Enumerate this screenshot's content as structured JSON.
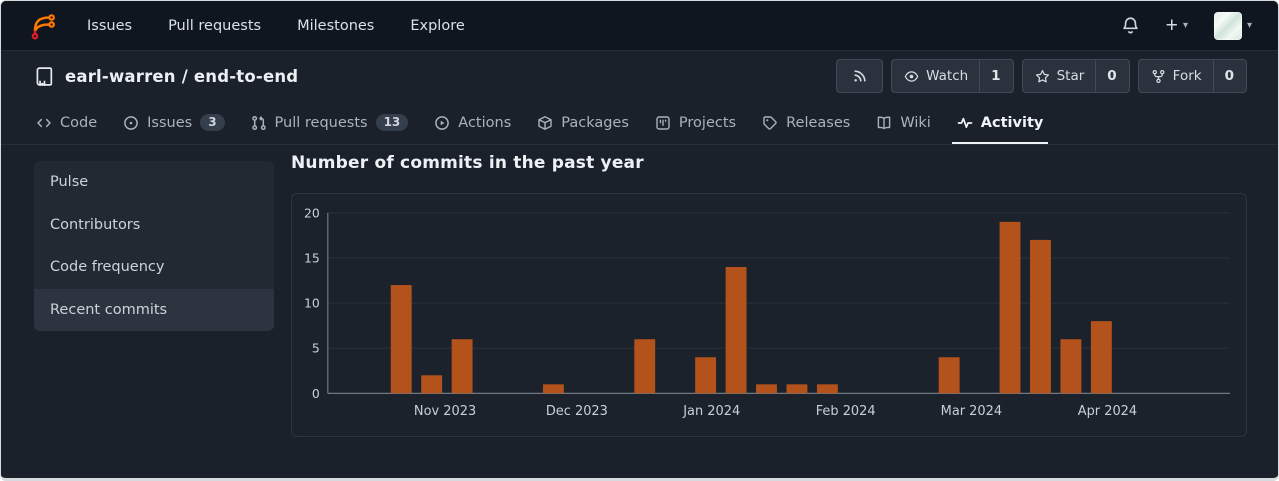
{
  "navbar": {
    "links": [
      {
        "label": "Issues"
      },
      {
        "label": "Pull requests"
      },
      {
        "label": "Milestones"
      },
      {
        "label": "Explore"
      }
    ]
  },
  "repo_header": {
    "owner": "earl-warren",
    "separator": "/",
    "name": "end-to-end",
    "full_title": "earl-warren / end-to-end",
    "watch_label": "Watch",
    "watch_count": "1",
    "star_label": "Star",
    "star_count": "0",
    "fork_label": "Fork",
    "fork_count": "0"
  },
  "tabs": [
    {
      "label": "Code"
    },
    {
      "label": "Issues",
      "badge": "3"
    },
    {
      "label": "Pull requests",
      "badge": "13"
    },
    {
      "label": "Actions"
    },
    {
      "label": "Packages"
    },
    {
      "label": "Projects"
    },
    {
      "label": "Releases"
    },
    {
      "label": "Wiki"
    },
    {
      "label": "Activity",
      "active": true
    }
  ],
  "sidebar": {
    "items": [
      {
        "label": "Pulse"
      },
      {
        "label": "Contributors"
      },
      {
        "label": "Code frequency"
      },
      {
        "label": "Recent commits",
        "active": true
      }
    ]
  },
  "chart_data": {
    "type": "bar",
    "title": "Number of commits in the past year",
    "x_unit": "week",
    "weekly_commits": [
      12,
      2,
      6,
      0,
      0,
      1,
      0,
      0,
      6,
      0,
      4,
      14,
      1,
      1,
      1,
      0,
      0,
      0,
      4,
      0,
      19,
      17,
      6,
      8,
      0,
      0,
      0
    ],
    "month_labels": [
      "Nov 2023",
      "Dec 2023",
      "Jan 2024",
      "Feb 2024",
      "Mar 2024",
      "Apr 2024"
    ],
    "month_label_week_positions": [
      1.44,
      5.77,
      10.2,
      14.6,
      18.73,
      23.2
    ],
    "y_ticks": [
      0,
      5,
      10,
      15,
      20
    ],
    "ylim": [
      0,
      20
    ],
    "grid": true,
    "legend": false,
    "bar_color": "#b4521c",
    "axis_color": "#6e7883",
    "grid_color": "#28313c",
    "tick_text_color": "#c9cfd6"
  },
  "colors": {
    "logo_orange": "#ff7800",
    "logo_red": "#e01b24"
  }
}
